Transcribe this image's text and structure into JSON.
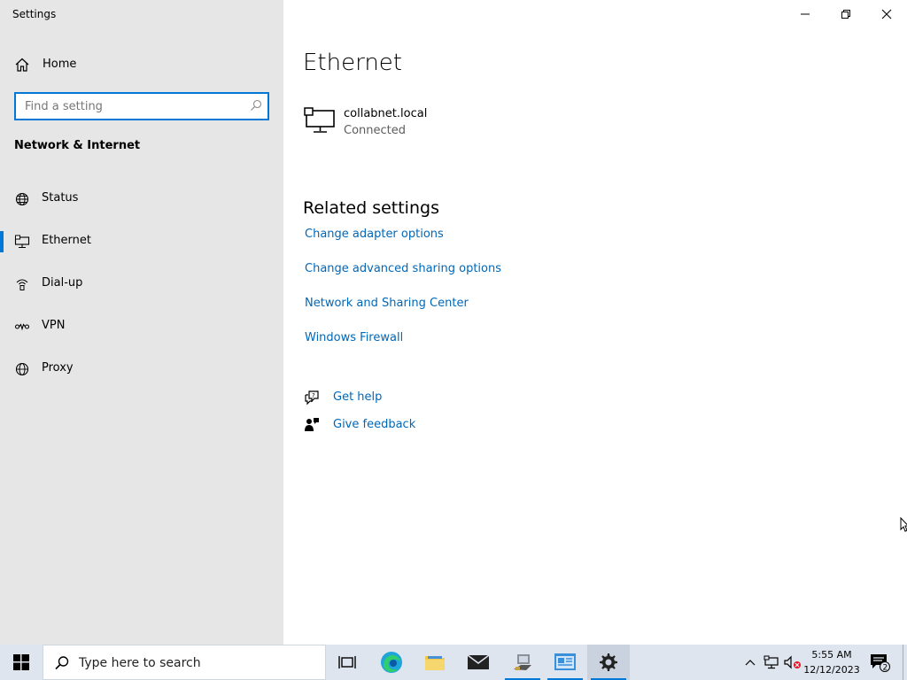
{
  "window": {
    "title": "Settings"
  },
  "sidebar": {
    "home_label": "Home",
    "search_placeholder": "Find a setting",
    "section_title": "Network & Internet",
    "items": [
      {
        "label": "Status",
        "icon": "globe-icon"
      },
      {
        "label": "Ethernet",
        "icon": "ethernet-icon",
        "active": true
      },
      {
        "label": "Dial-up",
        "icon": "dial-up-icon"
      },
      {
        "label": "VPN",
        "icon": "vpn-icon"
      },
      {
        "label": "Proxy",
        "icon": "globe-icon"
      }
    ]
  },
  "main": {
    "title": "Ethernet",
    "network": {
      "name": "collabnet.local",
      "status": "Connected"
    },
    "related_title": "Related settings",
    "links": [
      "Change adapter options",
      "Change advanced sharing options",
      "Network and Sharing Center",
      "Windows Firewall"
    ],
    "help": {
      "get_help": "Get help",
      "give_feedback": "Give feedback"
    }
  },
  "taskbar": {
    "search_placeholder": "Type here to search",
    "time": "5:55 AM",
    "date": "12/12/2023",
    "notification_count": "2"
  },
  "colors": {
    "accent": "#0078d7",
    "link": "#0067b8",
    "sidebar_bg": "#e6e6e6",
    "taskbar_bg": "#dfe5ee"
  }
}
